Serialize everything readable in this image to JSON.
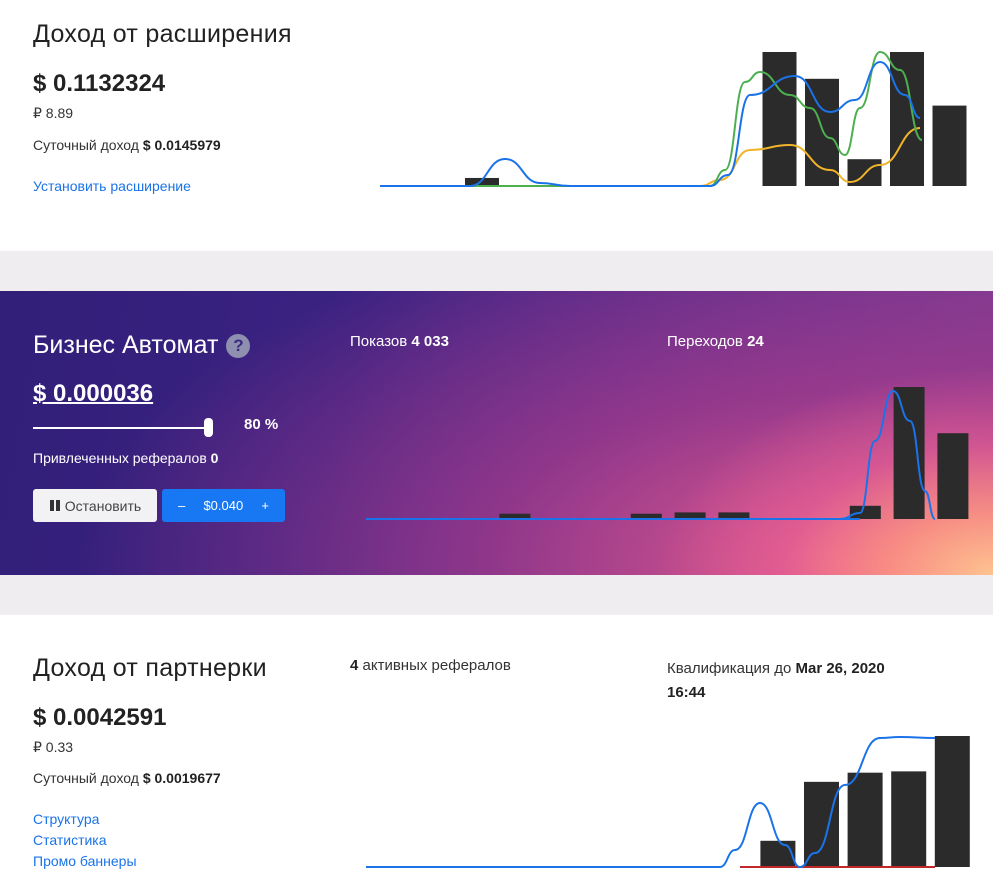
{
  "extension": {
    "title": "Доход от расширения",
    "amount": "$ 0.1132324",
    "rub": "₽ 8.89",
    "daily_label": "Суточный доход",
    "daily_value": "$ 0.0145979",
    "install_link": "Установить расширение",
    "colors": {
      "bars": "#2b2b2b",
      "line_blue": "#1a73e8",
      "line_green": "#4caf50",
      "line_yellow": "#f0b429"
    },
    "chart_data": {
      "type": "bar",
      "values": [
        0,
        0,
        0.06,
        0,
        0,
        0,
        0,
        0,
        0,
        1.0,
        0.8,
        0.2,
        1.0,
        0.6
      ]
    }
  },
  "business": {
    "title": "Бизнес Автомат",
    "help_icon": "question-circle-icon",
    "amount": "$ 0.000036",
    "slider_percent": "80 %",
    "slider_value": 0.8,
    "referrals_label": "Привлеченных рефералов",
    "referrals_value": "0",
    "stop_button": "Остановить",
    "pause_icon": "pause-icon",
    "minus_label": "–",
    "price": "$0.040",
    "plus_label": "+",
    "impressions_label": "Показов",
    "impressions_value": "4 033",
    "clicks_label": "Переходов",
    "clicks_value": "24",
    "chart_data": {
      "type": "bar",
      "values": [
        0,
        0,
        0,
        0.04,
        0,
        0,
        0.04,
        0.05,
        0.05,
        0,
        0,
        0.1,
        1.0,
        0.65
      ]
    }
  },
  "partner": {
    "title": "Доход от партнерки",
    "amount": "$ 0.0042591",
    "rub": "₽ 0.33",
    "daily_label": "Суточный доход",
    "daily_value": "$ 0.0019677",
    "links": [
      "Структура",
      "Статистика",
      "Промо баннеры"
    ],
    "active_referrals_value": "4",
    "active_referrals_label": "активных рефералов",
    "qualification_label": "Квалификация до",
    "qualification_value": "Mar 26, 2020",
    "qualification_time": "16:44",
    "chart_data": {
      "type": "bar",
      "values": [
        0,
        0,
        0,
        0,
        0,
        0,
        0,
        0,
        0,
        0.2,
        0.65,
        0.72,
        0.73,
        1.0
      ]
    }
  }
}
